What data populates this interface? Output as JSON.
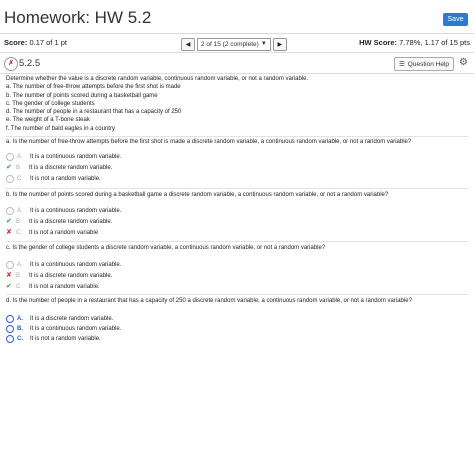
{
  "header": {
    "title": "Homework: HW 5.2",
    "save_label": "Save"
  },
  "scorebar": {
    "score_label": "Score:",
    "score_value": "0.17 of 1 pt",
    "nav_label": "2 of 15 (2 complete)",
    "hw_label": "HW Score:",
    "hw_value": "7.78%, 1.17 of 15 pts"
  },
  "question": {
    "number": "5.2.5",
    "help_label": "Question Help"
  },
  "intro": [
    "Determine whether the value is a discrete random variable, continuous random variable, or not a random variable.",
    "a. The number of free-throw attempts before the first shot is made",
    "b. The number of points scored during a basketball game",
    "c. The gender of college students",
    "d. The number of people in a restaurant that has a capacity of 250",
    "e. The weight of a T-bone steak",
    "f. The number of bald eagles in a country"
  ],
  "parts": [
    {
      "question": "a. Is the number of free-throw attempts before the first shot is made a discrete random variable, a continuous random variable, or not a random variable?",
      "options": [
        {
          "letter": "A.",
          "text": "It is a continuous random variable.",
          "mark": ""
        },
        {
          "letter": "B.",
          "text": "It is a discrete random variable.",
          "mark": "correct"
        },
        {
          "letter": "C.",
          "text": "It is not a random variable.",
          "mark": ""
        }
      ]
    },
    {
      "question": "b. Is the number of points scored during a basketball game a discrete random variable, a continuous random variable, or not a random variable?",
      "options": [
        {
          "letter": "A.",
          "text": "It is a continuous random variable.",
          "mark": ""
        },
        {
          "letter": "B.",
          "text": "It is a discrete random variable.",
          "mark": "correct"
        },
        {
          "letter": "C.",
          "text": "It is not a random variable",
          "mark": "incorrect"
        }
      ]
    },
    {
      "question": "c. Is the gender of college students a discrete random variable, a continuous random variable, or not a random variable?",
      "options": [
        {
          "letter": "A.",
          "text": "It is a continuous random variable.",
          "mark": ""
        },
        {
          "letter": "B.",
          "text": "It is a discrete random variable.",
          "mark": "incorrect"
        },
        {
          "letter": "C.",
          "text": "It is not a random variable.",
          "mark": "correct"
        }
      ]
    },
    {
      "question": "d. Is the number of people in a restaurant that has a capacity of 250 a discrete random variable, a continuous random variable, or not a random variable?",
      "options": [
        {
          "letter": "A.",
          "text": "It is a discrete random variable.",
          "mark": ""
        },
        {
          "letter": "B.",
          "text": "It is a continuous random variable.",
          "mark": ""
        },
        {
          "letter": "C.",
          "text": "It is not a random variable.",
          "mark": ""
        }
      ]
    }
  ],
  "colors": {
    "accent": "#2b7bd6",
    "correct": "#2e9e3a",
    "incorrect": "#d03030"
  }
}
